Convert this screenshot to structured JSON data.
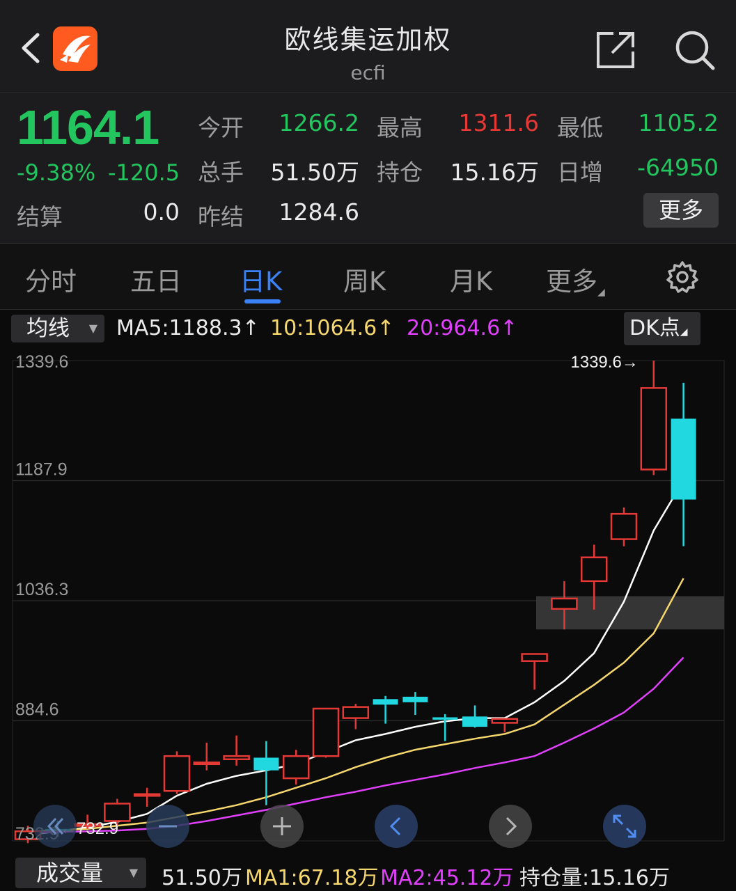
{
  "header": {
    "title": "欧线集运加权",
    "subtitle": "ecfi"
  },
  "quote": {
    "price": "1164.1",
    "change_pct": "-9.38%",
    "change_abs": "-120.5",
    "open_label": "今开",
    "open_value": "1266.2",
    "high_label": "最高",
    "high_value": "1311.6",
    "low_label": "最低",
    "low_value": "1105.2",
    "volume_label": "总手",
    "volume_value": "51.50万",
    "oi_label": "持仓",
    "oi_value": "15.16万",
    "daily_inc_label": "日增",
    "daily_inc_value": "-64950",
    "settle_label": "结算",
    "settle_value": "0.0",
    "prev_settle_label": "昨结",
    "prev_settle_value": "1284.6",
    "more_button": "更多"
  },
  "tabs": {
    "items": [
      "分时",
      "五日",
      "日K",
      "周K",
      "月K",
      "更多"
    ],
    "active": "日K"
  },
  "indicator_bar": {
    "selector": "均线",
    "ma5": "MA5:1188.3↑",
    "ma10": "10:1064.6↑",
    "ma20": "20:964.6↑",
    "dk_button": "DK点"
  },
  "chart_data": {
    "type": "candlestick",
    "y_ticks": [
      "1339.6",
      "1187.9",
      "1036.3",
      "884.6",
      "732.9"
    ],
    "ylim": [
      732.9,
      1339.6
    ],
    "max_label": "1339.6→",
    "min_label": "732.9",
    "candles": [
      {
        "open": 735,
        "close": 745,
        "high": 752,
        "low": 730
      },
      {
        "open": 748,
        "close": 746,
        "high": 758,
        "low": 738
      },
      {
        "open": 752,
        "close": 754,
        "high": 766,
        "low": 748
      },
      {
        "open": 758,
        "close": 780,
        "high": 786,
        "low": 752
      },
      {
        "open": 790,
        "close": 792,
        "high": 800,
        "low": 776
      },
      {
        "open": 796,
        "close": 840,
        "high": 846,
        "low": 792
      },
      {
        "open": 830,
        "close": 832,
        "high": 857,
        "low": 822
      },
      {
        "open": 836,
        "close": 840,
        "high": 866,
        "low": 828
      },
      {
        "open": 838,
        "close": 822,
        "high": 859,
        "low": 778
      },
      {
        "open": 812,
        "close": 840,
        "high": 848,
        "low": 804
      },
      {
        "open": 840,
        "close": 900,
        "high": 900,
        "low": 838
      },
      {
        "open": 888,
        "close": 902,
        "high": 906,
        "low": 874
      },
      {
        "open": 912,
        "close": 905,
        "high": 916,
        "low": 881
      },
      {
        "open": 915,
        "close": 908,
        "high": 921,
        "low": 892
      },
      {
        "open": 889,
        "close": 886,
        "high": 893,
        "low": 859
      },
      {
        "open": 890,
        "close": 877,
        "high": 904,
        "low": 876
      },
      {
        "open": 882,
        "close": 887,
        "high": 888,
        "low": 870
      },
      {
        "open": 960,
        "close": 969,
        "high": 969,
        "low": 924
      },
      {
        "open": 1026,
        "close": 1039,
        "high": 1061,
        "low": 1000
      },
      {
        "open": 1061,
        "close": 1091,
        "high": 1107,
        "low": 1025
      },
      {
        "open": 1114,
        "close": 1146,
        "high": 1154,
        "low": 1105
      },
      {
        "open": 1202,
        "close": 1305,
        "high": 1339.6,
        "low": 1195
      },
      {
        "open": 1266.2,
        "close": 1164.1,
        "high": 1311.6,
        "low": 1105.2
      }
    ],
    "ma_series": [
      {
        "name": "MA5",
        "color": "#ffffff",
        "values": [
          740,
          745,
          750,
          757,
          767,
          790,
          805,
          815,
          822,
          830,
          845,
          860,
          868,
          877,
          884,
          888,
          888,
          908,
          935,
          970,
          1035,
          1125,
          1188.3
        ]
      },
      {
        "name": "MA10",
        "color": "#f5d76e",
        "values": [
          745,
          746,
          748,
          752,
          756,
          763,
          770,
          778,
          788,
          800,
          812,
          826,
          838,
          848,
          855,
          862,
          868,
          880,
          905,
          930,
          958,
          995,
          1064.6
        ]
      },
      {
        "name": "MA20",
        "color": "#e040fb",
        "values": [
          744,
          744,
          745,
          746,
          748,
          752,
          758,
          765,
          772,
          780,
          788,
          795,
          803,
          810,
          817,
          825,
          832,
          840,
          857,
          875,
          895,
          925,
          964.6
        ]
      }
    ],
    "highlight_band": [
      1000,
      1042
    ]
  },
  "volume_bar": {
    "selector": "成交量",
    "volume": "51.50万",
    "ma1": "MA1:67.18万",
    "ma2": "MA2:45.12万",
    "oi": "持仓量:15.16万"
  },
  "colors": {
    "up": "#e53935",
    "down": "#22d8e0",
    "green": "#22c55e",
    "accent": "#3b82f6"
  }
}
